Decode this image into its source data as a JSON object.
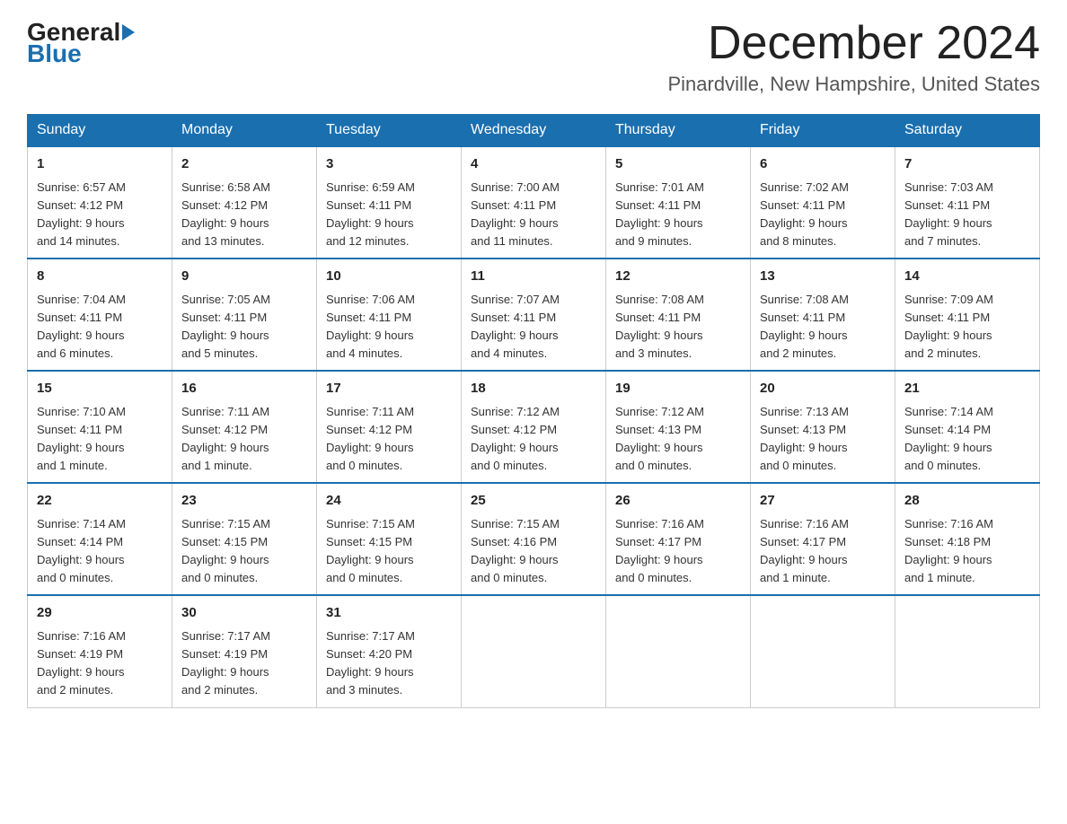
{
  "logo": {
    "general": "General",
    "blue": "Blue"
  },
  "header": {
    "month": "December 2024",
    "location": "Pinardville, New Hampshire, United States"
  },
  "weekdays": [
    "Sunday",
    "Monday",
    "Tuesday",
    "Wednesday",
    "Thursday",
    "Friday",
    "Saturday"
  ],
  "weeks": [
    [
      {
        "day": "1",
        "sunrise": "6:57 AM",
        "sunset": "4:12 PM",
        "daylight": "9 hours and 14 minutes."
      },
      {
        "day": "2",
        "sunrise": "6:58 AM",
        "sunset": "4:12 PM",
        "daylight": "9 hours and 13 minutes."
      },
      {
        "day": "3",
        "sunrise": "6:59 AM",
        "sunset": "4:11 PM",
        "daylight": "9 hours and 12 minutes."
      },
      {
        "day": "4",
        "sunrise": "7:00 AM",
        "sunset": "4:11 PM",
        "daylight": "9 hours and 11 minutes."
      },
      {
        "day": "5",
        "sunrise": "7:01 AM",
        "sunset": "4:11 PM",
        "daylight": "9 hours and 9 minutes."
      },
      {
        "day": "6",
        "sunrise": "7:02 AM",
        "sunset": "4:11 PM",
        "daylight": "9 hours and 8 minutes."
      },
      {
        "day": "7",
        "sunrise": "7:03 AM",
        "sunset": "4:11 PM",
        "daylight": "9 hours and 7 minutes."
      }
    ],
    [
      {
        "day": "8",
        "sunrise": "7:04 AM",
        "sunset": "4:11 PM",
        "daylight": "9 hours and 6 minutes."
      },
      {
        "day": "9",
        "sunrise": "7:05 AM",
        "sunset": "4:11 PM",
        "daylight": "9 hours and 5 minutes."
      },
      {
        "day": "10",
        "sunrise": "7:06 AM",
        "sunset": "4:11 PM",
        "daylight": "9 hours and 4 minutes."
      },
      {
        "day": "11",
        "sunrise": "7:07 AM",
        "sunset": "4:11 PM",
        "daylight": "9 hours and 4 minutes."
      },
      {
        "day": "12",
        "sunrise": "7:08 AM",
        "sunset": "4:11 PM",
        "daylight": "9 hours and 3 minutes."
      },
      {
        "day": "13",
        "sunrise": "7:08 AM",
        "sunset": "4:11 PM",
        "daylight": "9 hours and 2 minutes."
      },
      {
        "day": "14",
        "sunrise": "7:09 AM",
        "sunset": "4:11 PM",
        "daylight": "9 hours and 2 minutes."
      }
    ],
    [
      {
        "day": "15",
        "sunrise": "7:10 AM",
        "sunset": "4:11 PM",
        "daylight": "9 hours and 1 minute."
      },
      {
        "day": "16",
        "sunrise": "7:11 AM",
        "sunset": "4:12 PM",
        "daylight": "9 hours and 1 minute."
      },
      {
        "day": "17",
        "sunrise": "7:11 AM",
        "sunset": "4:12 PM",
        "daylight": "9 hours and 0 minutes."
      },
      {
        "day": "18",
        "sunrise": "7:12 AM",
        "sunset": "4:12 PM",
        "daylight": "9 hours and 0 minutes."
      },
      {
        "day": "19",
        "sunrise": "7:12 AM",
        "sunset": "4:13 PM",
        "daylight": "9 hours and 0 minutes."
      },
      {
        "day": "20",
        "sunrise": "7:13 AM",
        "sunset": "4:13 PM",
        "daylight": "9 hours and 0 minutes."
      },
      {
        "day": "21",
        "sunrise": "7:14 AM",
        "sunset": "4:14 PM",
        "daylight": "9 hours and 0 minutes."
      }
    ],
    [
      {
        "day": "22",
        "sunrise": "7:14 AM",
        "sunset": "4:14 PM",
        "daylight": "9 hours and 0 minutes."
      },
      {
        "day": "23",
        "sunrise": "7:15 AM",
        "sunset": "4:15 PM",
        "daylight": "9 hours and 0 minutes."
      },
      {
        "day": "24",
        "sunrise": "7:15 AM",
        "sunset": "4:15 PM",
        "daylight": "9 hours and 0 minutes."
      },
      {
        "day": "25",
        "sunrise": "7:15 AM",
        "sunset": "4:16 PM",
        "daylight": "9 hours and 0 minutes."
      },
      {
        "day": "26",
        "sunrise": "7:16 AM",
        "sunset": "4:17 PM",
        "daylight": "9 hours and 0 minutes."
      },
      {
        "day": "27",
        "sunrise": "7:16 AM",
        "sunset": "4:17 PM",
        "daylight": "9 hours and 1 minute."
      },
      {
        "day": "28",
        "sunrise": "7:16 AM",
        "sunset": "4:18 PM",
        "daylight": "9 hours and 1 minute."
      }
    ],
    [
      {
        "day": "29",
        "sunrise": "7:16 AM",
        "sunset": "4:19 PM",
        "daylight": "9 hours and 2 minutes."
      },
      {
        "day": "30",
        "sunrise": "7:17 AM",
        "sunset": "4:19 PM",
        "daylight": "9 hours and 2 minutes."
      },
      {
        "day": "31",
        "sunrise": "7:17 AM",
        "sunset": "4:20 PM",
        "daylight": "9 hours and 3 minutes."
      },
      null,
      null,
      null,
      null
    ]
  ],
  "labels": {
    "sunrise": "Sunrise:",
    "sunset": "Sunset:",
    "daylight": "Daylight:"
  }
}
